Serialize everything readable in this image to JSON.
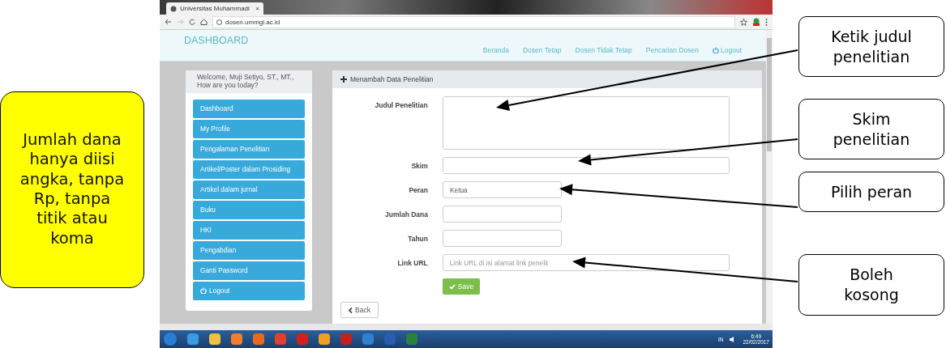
{
  "left_note": {
    "text": "Jumlah dana hanya diisi angka, tanpa Rp, tanpa titik atau koma"
  },
  "browser": {
    "tab_title": "Universitas Muhammadi",
    "tab_close": "×",
    "url": "dosen.ummgl.ac.id"
  },
  "navbar": {
    "brand": "DASHBOARD",
    "links": [
      "Beranda",
      "Dosen Tetap",
      "Dosen Tidak Tetap",
      "Pencarian Dosen"
    ],
    "logout": "Logout"
  },
  "sidebar": {
    "welcome": "Welcome, Muji Setiyo, ST., MT.,",
    "subtitle": "How are you today?",
    "items": [
      {
        "label": "Dashboard",
        "kind": "link"
      },
      {
        "label": "My Profile",
        "kind": "link"
      },
      {
        "label": "Pengalaman Penelitian",
        "kind": "link"
      },
      {
        "label": "Artikel/Poster dalam Prosiding",
        "kind": "link"
      },
      {
        "label": "Artikel dalam jurnal",
        "kind": "link"
      },
      {
        "label": "Buku",
        "kind": "link"
      },
      {
        "label": "HKI",
        "kind": "link"
      },
      {
        "label": "Pengabdian",
        "kind": "link"
      },
      {
        "label": "Ganti Password",
        "kind": "link"
      },
      {
        "label": "Logout",
        "kind": "logout"
      }
    ]
  },
  "form": {
    "title": "Menambah Data Penelitian",
    "fields": [
      {
        "label": "Judul Penelitian",
        "kind": "textarea"
      },
      {
        "label": "Skim",
        "kind": "text"
      },
      {
        "label": "Peran",
        "kind": "select",
        "value": "Ketua"
      },
      {
        "label": "Jumlah Dana",
        "kind": "text"
      },
      {
        "label": "Tahun",
        "kind": "text"
      },
      {
        "label": "Link URL",
        "kind": "text",
        "placeholder": "Link URL di isi alamat link penelit"
      }
    ],
    "save": "Save",
    "back": "Back"
  },
  "taskbar": {
    "language": "IN",
    "time": "6:49",
    "date": "22/02/2017"
  },
  "callouts": [
    {
      "text": "Ketik judul penelitian"
    },
    {
      "text": "Skim penelitian"
    },
    {
      "text": "Pilih peran"
    },
    {
      "text": "Boleh kosong"
    }
  ]
}
